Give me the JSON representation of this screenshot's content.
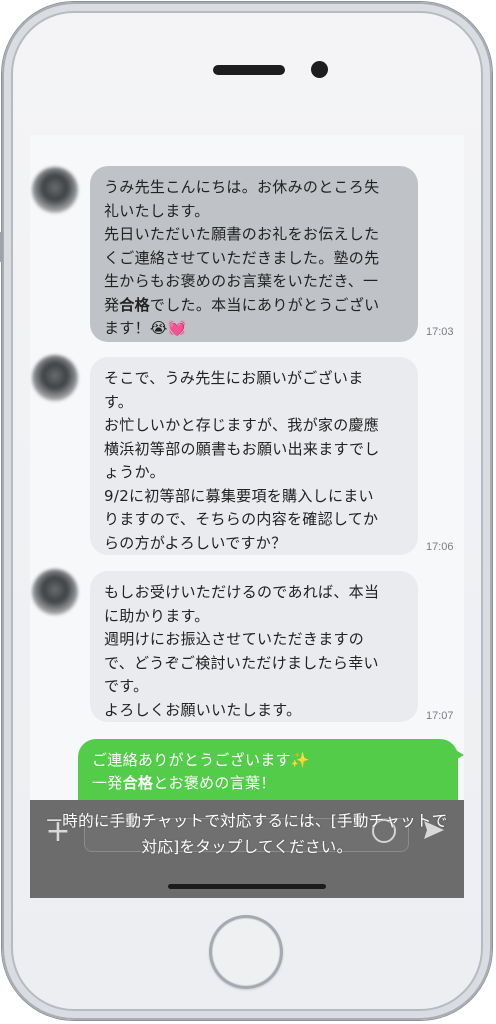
{
  "chat": {
    "messages": [
      {
        "lines": [
          "うみ先生こんにちは。お休みのところ失",
          "礼いたします。",
          "先日いただいた願書のお礼をお伝えした",
          "くご連絡させていただきました。塾の先",
          "生からもお褒めのお言葉をいただき、一"
        ],
        "line6_prefix": "発",
        "line6_bold": "合格",
        "line6_suffix": "でした。本当にありがとうござい",
        "line7": "ます！",
        "emoji": "😭💓",
        "time": "17:03"
      },
      {
        "text": "そこで、うみ先生にお願いがございま\nす。\nお忙しいかと存じますが、我が家の慶應\n横浜初等部の願書もお願い出来ますでし\nょうか。\n9/2に初等部に募集要項を購入しにまい\nりますので、そちらの内容を確認してか\nらの方がよろしいですか？",
        "time": "17:06"
      },
      {
        "text": "もしお受けいただけるのであれば、本当\nに助かります。\n週明けにお振込させていただきますの\nで、どうぞご検討いただけましたら幸い\nです。\nよろしくお願いいたします。",
        "time": "17:07"
      }
    ],
    "outgoing": {
      "line1": "ご連絡ありがとうございます✨",
      "line2_prefix": "一発",
      "line2_bold": "合格",
      "line2_suffix": "とお褒めの言葉！"
    }
  },
  "input_bar": {
    "notice_line1": "一時的に手動チャットで対応するには、[手動チャットで",
    "notice_line2": "対応]をタップしてください。",
    "plus_icon": "+"
  }
}
